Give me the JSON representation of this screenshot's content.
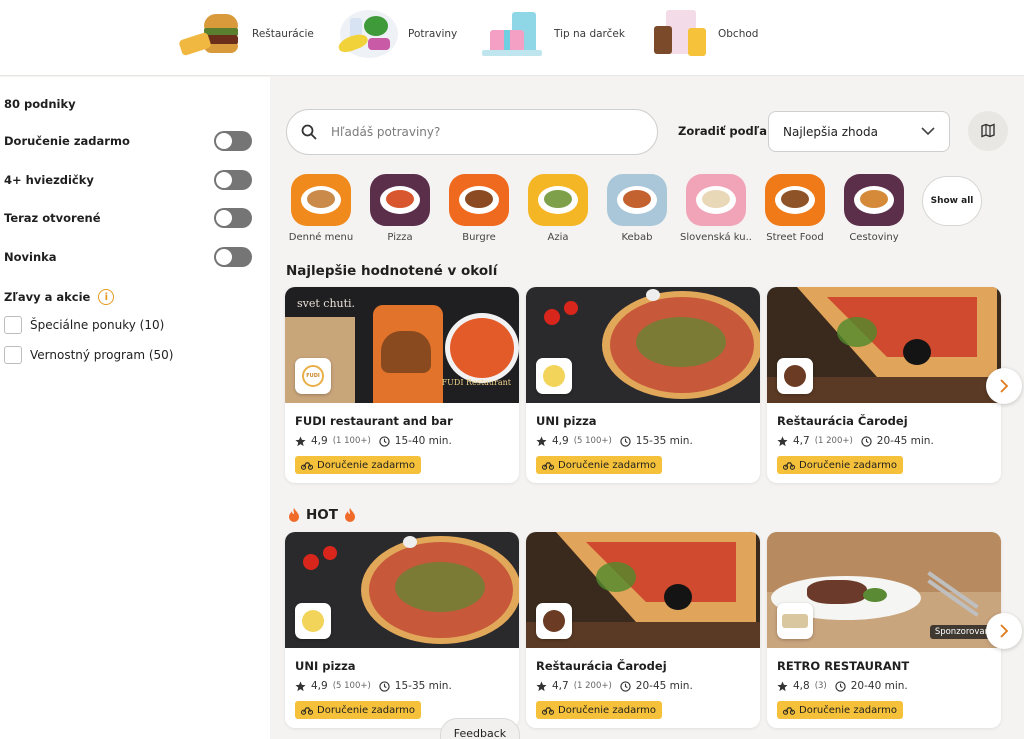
{
  "top_categories": [
    {
      "label": "Reštaurácie",
      "icon": "burger-fries-icon"
    },
    {
      "label": "Potraviny",
      "icon": "groceries-icon"
    },
    {
      "label": "Tip na darček",
      "icon": "gift-icon"
    },
    {
      "label": "Obchod",
      "icon": "shop-bag-icon"
    }
  ],
  "sidebar": {
    "count": "80 podniky",
    "filters": [
      {
        "label": "Doručenie zadarmo",
        "on": false
      },
      {
        "label": "4+ hviezdičky",
        "on": false
      },
      {
        "label": "Teraz otvorené",
        "on": false
      },
      {
        "label": "Novinka",
        "on": false
      }
    ],
    "section": "Zľavy a akcie",
    "checks": [
      {
        "label": "Špeciálne ponuky (10)"
      },
      {
        "label": "Vernostný program (50)"
      }
    ]
  },
  "search": {
    "placeholder": "Hľadáš potraviny?"
  },
  "sort": {
    "label": "Zoradiť podľa",
    "value": "Najlepšia zhoda"
  },
  "categories": [
    {
      "label": "Denné menu",
      "bg": "#f08a1c",
      "food": "#c98a4a"
    },
    {
      "label": "Pizza",
      "bg": "#5b2f4a",
      "food": "#d9572f"
    },
    {
      "label": "Burgre",
      "bg": "#ef6a1f",
      "food": "#8b4a22"
    },
    {
      "label": "Ázia",
      "bg": "#f5b626",
      "food": "#7fa04a"
    },
    {
      "label": "Kebab",
      "bg": "#a9c7d8",
      "food": "#c4622f"
    },
    {
      "label": "Slovenská ku...",
      "bg": "#f1a3b7",
      "food": "#e9d8b8"
    },
    {
      "label": "Street Food",
      "bg": "#ef7a17",
      "food": "#8e5428"
    },
    {
      "label": "Cestoviny",
      "bg": "#5b2f4a",
      "food": "#d58a3a"
    }
  ],
  "show_all": "Show all",
  "sections": {
    "top_rated": "Najlepšie hodnotené v okolí",
    "hot": "HOT"
  },
  "top_rated": [
    {
      "name": "FUDI restaurant and bar",
      "rating": "4,9",
      "count": "(1 100+)",
      "time": "15-40 min.",
      "badge": "Doručenie zadarmo",
      "img": "fudi",
      "logo": "#e9b04a",
      "overlay_title": "svet chuti.",
      "overlay_brand": "FUDI Restaurant",
      "logo_text": "FUDI"
    },
    {
      "name": "UNI pizza",
      "rating": "4,9",
      "count": "(5 100+)",
      "time": "15-35 min.",
      "badge": "Doručenie zadarmo",
      "img": "pizza",
      "logo": "#f3d45a"
    },
    {
      "name": "Reštaurácia Čarodej",
      "rating": "4,7",
      "count": "(1 200+)",
      "time": "20-45 min.",
      "badge": "Doručenie zadarmo",
      "img": "slice",
      "logo": "#6b3b24"
    }
  ],
  "hot": [
    {
      "name": "UNI pizza",
      "rating": "4,9",
      "count": "(5 100+)",
      "time": "15-35 min.",
      "badge": "Doručenie zadarmo",
      "img": "pizza",
      "logo": "#f3d45a"
    },
    {
      "name": "Reštaurácia Čarodej",
      "rating": "4,7",
      "count": "(1 200+)",
      "time": "20-45 min.",
      "badge": "Doručenie zadarmo",
      "img": "slice",
      "logo": "#6b3b24"
    },
    {
      "name": "RETRO RESTAURANT",
      "rating": "4,8",
      "count": "(3)",
      "time": "20-40 min.",
      "badge": "Doručenie zadarmo",
      "img": "retro",
      "logo": "#d9c7a0",
      "sponsored": "Sponzorovan"
    }
  ],
  "feedback": "Feedback",
  "colors": {
    "accent": "#f5c13a",
    "toggle": "#757575",
    "info": "#e69a1c"
  }
}
